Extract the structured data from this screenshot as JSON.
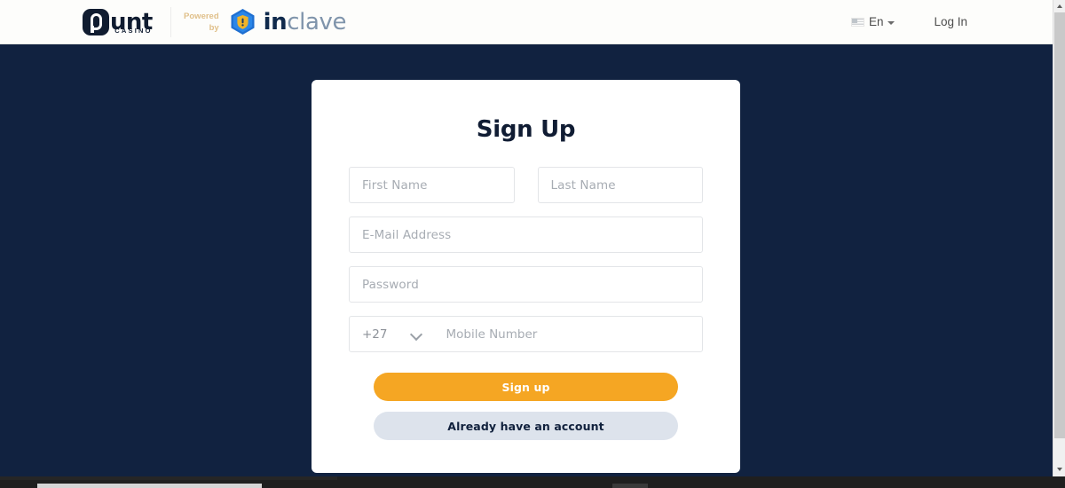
{
  "header": {
    "brand": {
      "punt_word": "unt",
      "punt_sub": "CASINO",
      "punt_logo_name": "Punt Casino"
    },
    "powered_by": "Powered by",
    "inclave": {
      "prefix": "in",
      "suffix": "clave",
      "icon": "shield-hexagon-icon"
    },
    "language": {
      "label": "En",
      "flag_icon": "us-flag-icon",
      "caret_icon": "chevron-down-icon"
    },
    "login_label": "Log In"
  },
  "card": {
    "title": "Sign Up",
    "fields": {
      "first_name": {
        "placeholder": "First Name",
        "value": ""
      },
      "last_name": {
        "placeholder": "Last Name",
        "value": ""
      },
      "email": {
        "placeholder": "E-Mail Address",
        "value": ""
      },
      "password": {
        "placeholder": "Password",
        "value": ""
      },
      "country_code": "+27",
      "mobile": {
        "placeholder": "Mobile Number",
        "value": ""
      }
    },
    "buttons": {
      "signup": "Sign up",
      "existing_account": "Already have an account"
    }
  },
  "colors": {
    "page_bg": "#112240",
    "card_bg": "#ffffff",
    "accent_orange": "#f5a623",
    "secondary_button": "#dde3ec",
    "navy_text": "#101c33",
    "placeholder": "#a7acb3",
    "powered_by": "#e0c08a",
    "inclave_blue": "#1f6fd0",
    "inclave_gold": "#f0b429"
  },
  "scrollbar": {
    "up_icon": "scroll-up-arrow-icon",
    "down_icon": "scroll-down-arrow-icon"
  }
}
